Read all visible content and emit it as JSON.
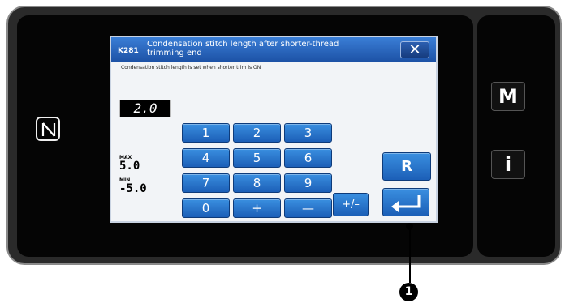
{
  "dialog": {
    "code": "K281",
    "title": "Condensation stitch length after shorter-thread trimming end",
    "message": "Condensation stitch length is set when shorter trim is ON",
    "close_label": "✕"
  },
  "value": {
    "current": "2.0",
    "max_label": "MAX",
    "max_value": "5.0",
    "min_label": "MIN",
    "min_value": "-5.0"
  },
  "keypad": {
    "k1": "1",
    "k2": "2",
    "k3": "3",
    "k4": "4",
    "k5": "5",
    "k6": "6",
    "k7": "7",
    "k8": "8",
    "k9": "9",
    "k0": "0",
    "plus": "+",
    "minus": "—",
    "sign": "+/–",
    "reset": "R"
  },
  "side_buttons": {
    "mode": "M",
    "info": "i"
  },
  "icons": {
    "nfc": "nfc-icon",
    "enter": "enter-icon",
    "close": "close-icon"
  },
  "callout": {
    "number": "1"
  },
  "colors": {
    "key_blue": "#2a76d0",
    "title_blue": "#2c6ac4"
  }
}
